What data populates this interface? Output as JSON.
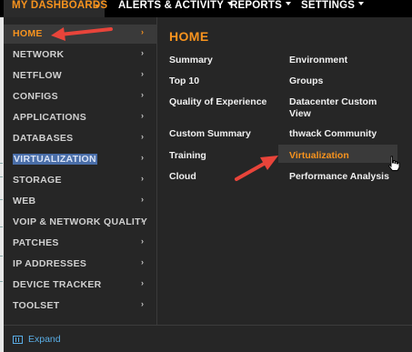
{
  "topnav": {
    "tabs": [
      {
        "label": "MY DASHBOARDS"
      },
      {
        "label": "ALERTS & ACTIVITY"
      },
      {
        "label": "REPORTS"
      },
      {
        "label": "SETTINGS"
      }
    ]
  },
  "menu": {
    "left_items": [
      {
        "label": "HOME",
        "arrow": "›"
      },
      {
        "label": "NETWORK",
        "arrow": "›"
      },
      {
        "label": "NETFLOW",
        "arrow": "›"
      },
      {
        "label": "CONFIGS",
        "arrow": "›"
      },
      {
        "label": "APPLICATIONS",
        "arrow": "›"
      },
      {
        "label": "DATABASES",
        "arrow": "›"
      },
      {
        "label": "VIRTUALIZATION",
        "arrow": "›"
      },
      {
        "label": "STORAGE",
        "arrow": "›"
      },
      {
        "label": "WEB",
        "arrow": "›"
      },
      {
        "label": "VOIP & NETWORK QUALITY",
        "arrow": "›"
      },
      {
        "label": "PATCHES",
        "arrow": "›"
      },
      {
        "label": "IP ADDRESSES",
        "arrow": "›"
      },
      {
        "label": "DEVICE TRACKER",
        "arrow": "›"
      },
      {
        "label": "TOOLSET",
        "arrow": "›"
      }
    ],
    "section_title": "HOME",
    "links_col1": [
      "Summary",
      "Top 10",
      "Quality of Experience",
      "Custom Summary",
      "Training",
      "Cloud"
    ],
    "links_col2": [
      "Environment",
      "Groups",
      "Datacenter Custom",
      "View",
      "thwack Community",
      "Virtualization",
      "Performance Analysis"
    ]
  },
  "footer": {
    "expand_label": "Expand",
    "icon": "expand-icon"
  },
  "colors": {
    "accent": "#f7931e",
    "topbar": "#000000",
    "menu_bg": "#262626",
    "link_blue": "#5aaee6",
    "annotation_arrow": "#e8443a"
  }
}
